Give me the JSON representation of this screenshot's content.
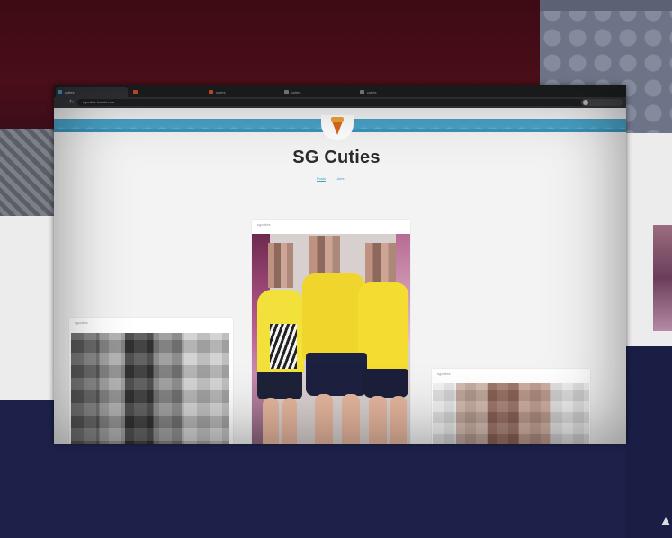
{
  "browser": {
    "tabs": [
      {
        "label": "cuties",
        "color": "#4aa3c9"
      },
      {
        "label": "",
        "color": "#e0562d"
      },
      {
        "label": "cuties",
        "color": "#e0562d"
      },
      {
        "label": "cuties",
        "color": "#8a8a8a"
      },
      {
        "label": "cuties",
        "color": "#8a8a8a"
      }
    ],
    "url": "sgcuties.tumblr.com",
    "profile_label": ""
  },
  "blog": {
    "title": "SG Cuties",
    "nav": [
      "Posts",
      "Likes"
    ]
  },
  "posts": [
    {
      "caption": "sgcuties"
    },
    {
      "caption": "sgcuties"
    },
    {
      "caption": "sgcuties"
    }
  ]
}
